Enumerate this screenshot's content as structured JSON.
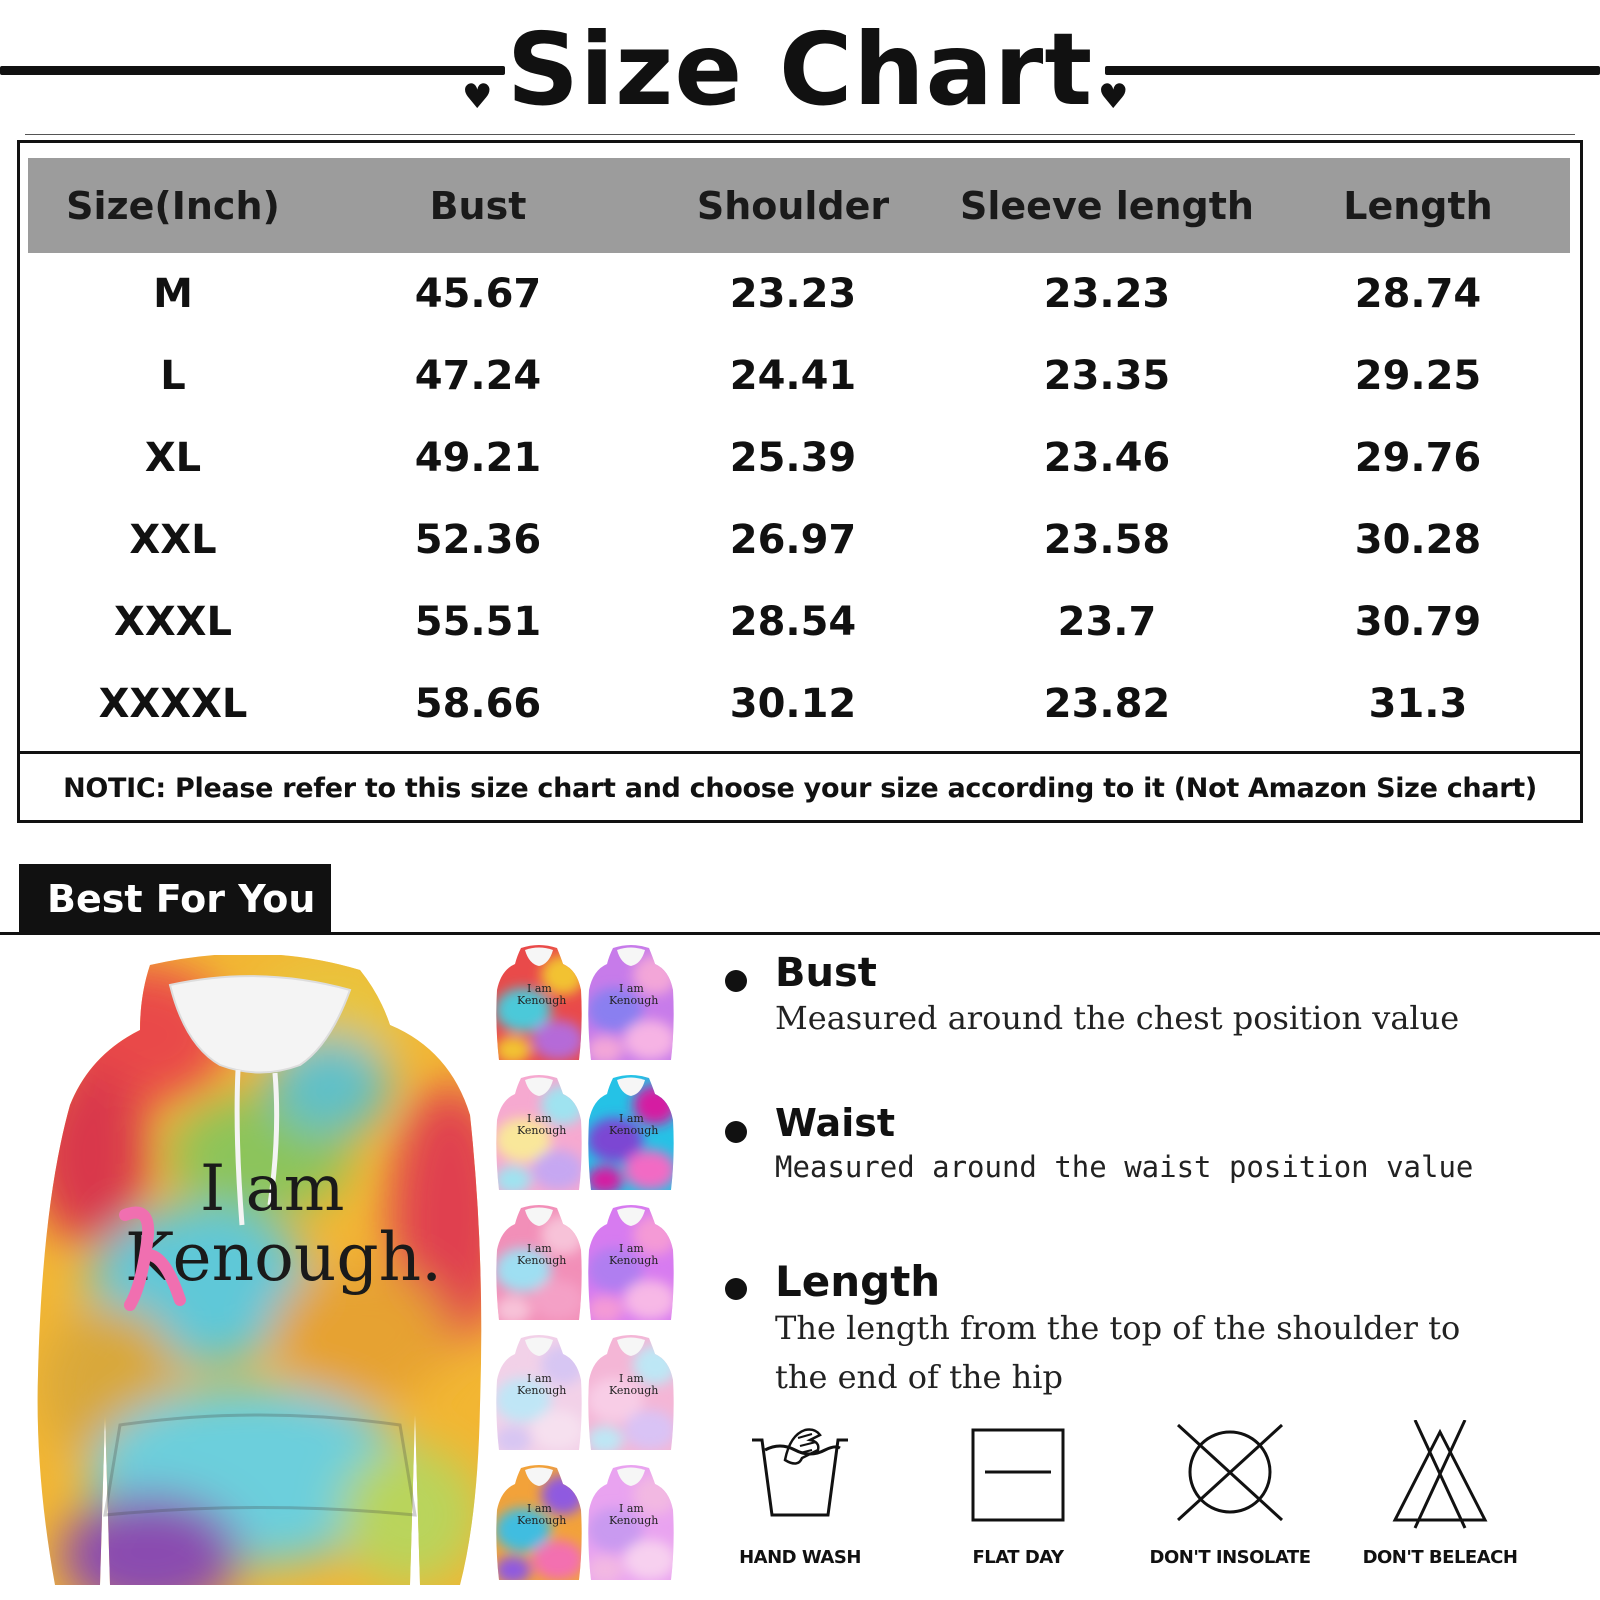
{
  "title": "Size Chart",
  "table": {
    "headers": [
      "Size(Inch)",
      "Bust",
      "Shoulder",
      "Sleeve length",
      "Length"
    ],
    "rows": [
      [
        "M",
        "45.67",
        "23.23",
        "23.23",
        "28.74"
      ],
      [
        "L",
        "47.24",
        "24.41",
        "23.35",
        "29.25"
      ],
      [
        "XL",
        "49.21",
        "25.39",
        "23.46",
        "29.76"
      ],
      [
        "XXL",
        "52.36",
        "26.97",
        "23.58",
        "30.28"
      ],
      [
        "XXXL",
        "55.51",
        "28.54",
        "23.7",
        "30.79"
      ],
      [
        "XXXXL",
        "58.66",
        "30.12",
        "23.82",
        "31.3"
      ]
    ],
    "notice": "NOTIC: Please refer to this size chart and choose your size according to it (Not Amazon Size chart)"
  },
  "best_for_you": "Best For You",
  "product": {
    "print_line1": "I am",
    "print_line2": "Kenough."
  },
  "thumb_print": {
    "line1": "I am",
    "line2": "Kenough"
  },
  "thumbnails": [
    {
      "colors": [
        "#e94a4a",
        "#f2c230",
        "#4cc9d9",
        "#b56ad8"
      ]
    },
    {
      "colors": [
        "#c77bea",
        "#f3a6d8",
        "#8a7ff0",
        "#f6b3e4"
      ]
    },
    {
      "colors": [
        "#f6a9d0",
        "#9fe3f0",
        "#f9e79a",
        "#c6a7f2"
      ]
    },
    {
      "colors": [
        "#25c2e6",
        "#d51fa2",
        "#7b46d3",
        "#f26ac4"
      ]
    },
    {
      "colors": [
        "#f28fb8",
        "#f7c2d8",
        "#9edff2",
        "#f4a0c6"
      ]
    },
    {
      "colors": [
        "#d77bf0",
        "#f49ad6",
        "#b07ef0",
        "#f7b8e6"
      ]
    },
    {
      "colors": [
        "#f2d1e8",
        "#d7c6f3",
        "#bfe6f6",
        "#f6e0ef"
      ]
    },
    {
      "colors": [
        "#f4b6d6",
        "#bde7f5",
        "#f8cde6",
        "#d9c3f5"
      ]
    },
    {
      "colors": [
        "#f2a23a",
        "#8f5ae0",
        "#3fbde0",
        "#f36fb0"
      ]
    },
    {
      "colors": [
        "#e9a3f0",
        "#f2b8e2",
        "#c99af0",
        "#f7d0ef"
      ]
    }
  ],
  "measurements": [
    {
      "name": "Bust",
      "desc": [
        "Measured around the chest position value"
      ]
    },
    {
      "name": "Waist",
      "desc": [
        "Measured around the waist position value"
      ]
    },
    {
      "name": "Length",
      "desc": [
        "The length from the top of the shoulder to",
        "the end of the hip"
      ]
    }
  ],
  "care": [
    {
      "label": "HAND WASH",
      "icon": "hand-wash-icon"
    },
    {
      "label": "FLAT DAY",
      "icon": "flat-dry-icon"
    },
    {
      "label": "DON'T INSOLATE",
      "icon": "no-tumble-dry-icon"
    },
    {
      "label": "DON'T BELEACH",
      "icon": "no-bleach-icon"
    }
  ]
}
